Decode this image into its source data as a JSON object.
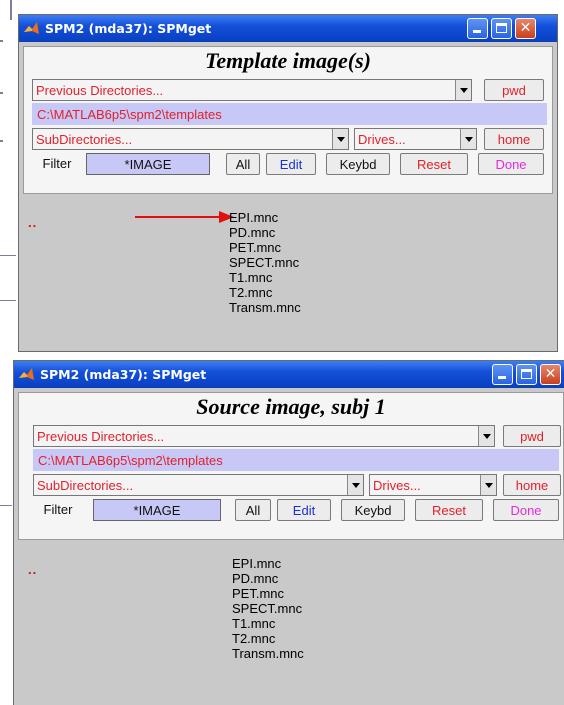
{
  "windows": [
    {
      "title": "SPM2 (mda37): SPMget",
      "heading": "Template image(s)",
      "prev_dirs": "Previous Directories...",
      "pwd": "pwd",
      "path": "C:\\MATLAB6p5\\spm2\\templates",
      "subdirs": "SubDirectories...",
      "drives": "Drives...",
      "home": "home",
      "filter_label": "Filter",
      "filter_value": "*IMAGE",
      "all": "All",
      "edit": "Edit",
      "keybd": "Keybd",
      "reset": "Reset",
      "done": "Done",
      "parent_dir": "..",
      "files": [
        "EPI.mnc",
        "PD.mnc",
        "PET.mnc",
        "SPECT.mnc",
        "T1.mnc",
        "T2.mnc",
        "Transm.mnc"
      ]
    },
    {
      "title": "SPM2 (mda37): SPMget",
      "heading": "Source image, subj 1",
      "prev_dirs": "Previous Directories...",
      "pwd": "pwd",
      "path": "C:\\MATLAB6p5\\spm2\\templates",
      "subdirs": "SubDirectories...",
      "drives": "Drives...",
      "home": "home",
      "filter_label": "Filter",
      "filter_value": "*IMAGE",
      "all": "All",
      "edit": "Edit",
      "keybd": "Keybd",
      "reset": "Reset",
      "done": "Done",
      "parent_dir": "..",
      "files": [
        "EPI.mnc",
        "PD.mnc",
        "PET.mnc",
        "SPECT.mnc",
        "T1.mnc",
        "T2.mnc",
        "Transm.mnc"
      ]
    }
  ],
  "colors": {
    "titlebar": "#0b44c8",
    "panel_bg": "#c9c9c9",
    "path_bg": "#c8c8f7",
    "red_text": "#e3202a",
    "blue_text": "#1a2fd4",
    "done_text": "#e42adb",
    "annotation_arrow": "#e01010"
  },
  "icons": [
    "matlab-logo-icon",
    "minimize-icon",
    "maximize-icon",
    "close-icon",
    "dropdown-arrow-icon",
    "red-arrow-annotation"
  ]
}
